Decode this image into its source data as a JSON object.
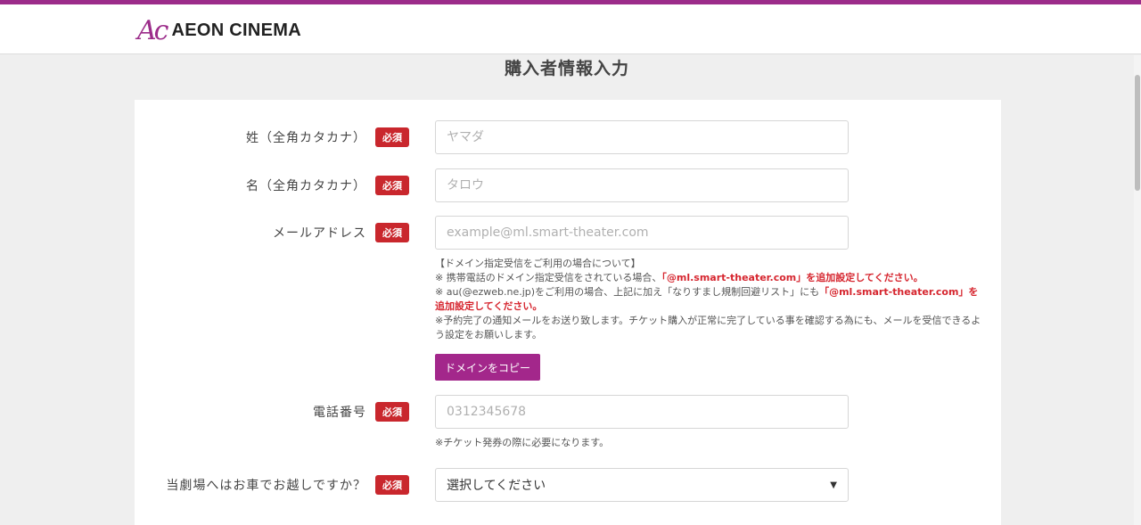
{
  "header": {
    "logo_mark": "Ac",
    "brand": "AEON CINEMA"
  },
  "page": {
    "title": "購入者情報入力"
  },
  "form": {
    "required_badge": "必須",
    "last_name": {
      "label": "姓（全角カタカナ）",
      "placeholder": "ヤマダ"
    },
    "first_name": {
      "label": "名（全角カタカナ）",
      "placeholder": "タロウ"
    },
    "email": {
      "label": "メールアドレス",
      "placeholder": "example@ml.smart-theater.com",
      "notes": {
        "line1": "【ドメイン指定受信をご利用の場合について】",
        "line2_pre": "※ 携帯電話のドメイン指定受信をされている場合、",
        "line2_red": "「@ml.smart-theater.com」を追加設定してください。",
        "line3_pre": "※ au(@ezweb.ne.jp)をご利用の場合、上記に加え「なりすまし規制回避リスト」にも",
        "line3_red": "「@ml.smart-theater.com」を追加設定してください。",
        "line4": "※予約完了の通知メールをお送り致します。チケット購入が正常に完了している事を確認する為にも、メールを受信できるよう設定をお願いします。"
      },
      "copy_button": "ドメインをコピー"
    },
    "phone": {
      "label": "電話番号",
      "placeholder": "0312345678",
      "note": "※チケット発券の際に必要になります。"
    },
    "car": {
      "label": "当劇場へはお車でお越しですか？",
      "selected": "選択してください"
    }
  },
  "colors": {
    "accent": "#9c2c8a",
    "button": "#a3278b",
    "required": "#c9272d",
    "warning_text": "#d6262f"
  },
  "icons": {
    "select_caret": "caret-down-icon"
  }
}
